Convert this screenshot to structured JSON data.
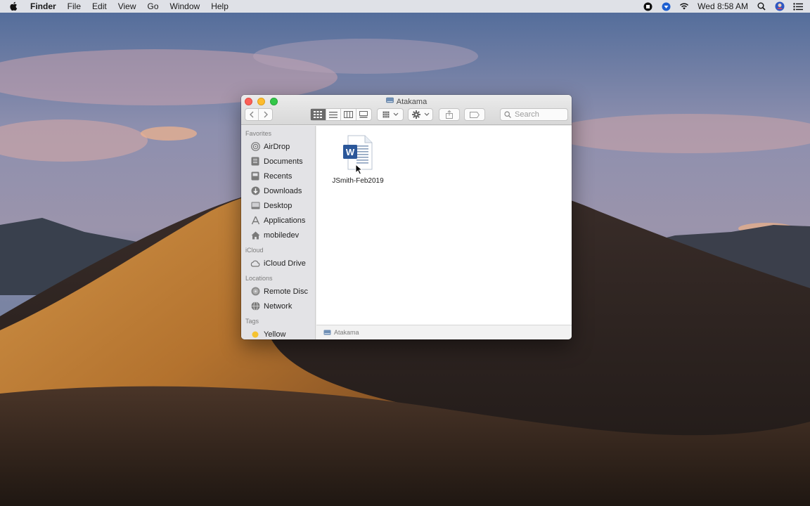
{
  "menubar": {
    "apple_icon": "apple-icon",
    "app_name": "Finder",
    "items": [
      "File",
      "Edit",
      "View",
      "Go",
      "Window",
      "Help"
    ],
    "clock": "Wed 8:58 AM",
    "status_icons": [
      "record-icon",
      "vpn-icon",
      "wifi-icon",
      "search-icon",
      "user-icon",
      "list-icon"
    ]
  },
  "window": {
    "title": "Atakama",
    "search_placeholder": "Search",
    "sidebar": {
      "favorites_header": "Favorites",
      "favorites": [
        {
          "label": "AirDrop",
          "icon": "airdrop-icon"
        },
        {
          "label": "Documents",
          "icon": "documents-icon"
        },
        {
          "label": "Recents",
          "icon": "recents-icon"
        },
        {
          "label": "Downloads",
          "icon": "downloads-icon"
        },
        {
          "label": "Desktop",
          "icon": "desktop-icon"
        },
        {
          "label": "Applications",
          "icon": "applications-icon"
        },
        {
          "label": "mobiledev",
          "icon": "home-icon"
        }
      ],
      "icloud_header": "iCloud",
      "icloud": [
        {
          "label": "iCloud Drive",
          "icon": "cloud-icon"
        }
      ],
      "locations_header": "Locations",
      "locations": [
        {
          "label": "Remote Disc",
          "icon": "disc-icon"
        },
        {
          "label": "Network",
          "icon": "network-icon"
        }
      ],
      "tags_header": "Tags",
      "tags": [
        {
          "label": "Yellow",
          "color": "#f5c330"
        }
      ]
    },
    "files": [
      {
        "name": "JSmith-Feb2019",
        "icon": "word-document-icon"
      }
    ],
    "pathbar": "Atakama"
  },
  "colors": {
    "traffic_close": "#fc5f57",
    "traffic_min": "#fdbc2e",
    "traffic_max": "#33c748",
    "word_blue": "#2b579a"
  }
}
